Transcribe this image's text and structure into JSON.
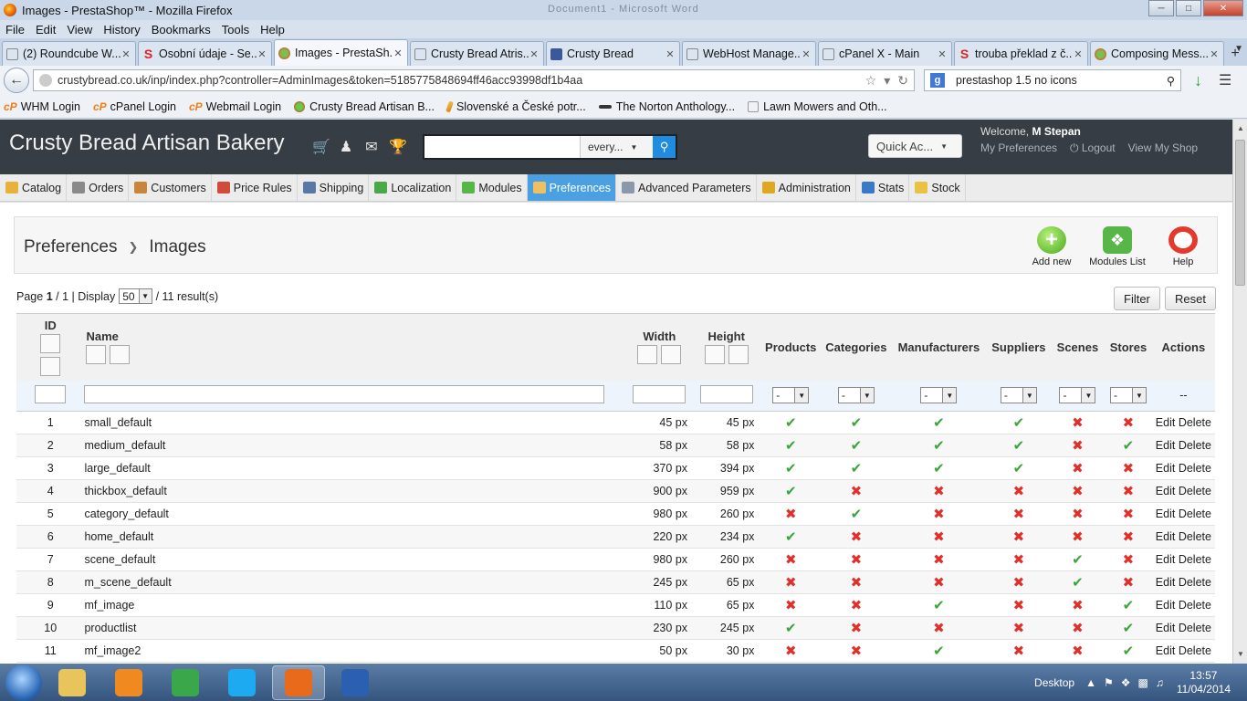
{
  "window": {
    "title": "Images - PrestaShop™ - Mozilla Firefox",
    "background_ghost": "Document1 - Microsoft Word"
  },
  "menubar": [
    "File",
    "Edit",
    "View",
    "History",
    "Bookmarks",
    "Tools",
    "Help"
  ],
  "tabs": [
    {
      "label": "(2) Roundcube W...",
      "icon": "blank"
    },
    {
      "label": "Osobní údaje - Se...",
      "icon": "seznam"
    },
    {
      "label": "Images - PrestaSh...",
      "icon": "prestashop",
      "active": true
    },
    {
      "label": "Crusty Bread Atris...",
      "icon": "blank"
    },
    {
      "label": "Crusty Bread",
      "icon": "facebook"
    },
    {
      "label": "WebHost Manage...",
      "icon": "blank"
    },
    {
      "label": "cPanel X - Main",
      "icon": "blank"
    },
    {
      "label": "trouba překlad z č...",
      "icon": "seznam"
    },
    {
      "label": "Composing Mess...",
      "icon": "prestashop"
    }
  ],
  "nav": {
    "url": "crustybread.co.uk/inp/index.php?controller=AdminImages&token=5185775848694ff46acc93998df1b4aa",
    "search_value": "prestashop 1.5 no icons"
  },
  "bookmarks": [
    {
      "label": "WHM Login",
      "icon": "cp"
    },
    {
      "label": "cPanel Login",
      "icon": "cp"
    },
    {
      "label": "Webmail Login",
      "icon": "cp"
    },
    {
      "label": "Crusty Bread Artisan B...",
      "icon": "green"
    },
    {
      "label": "Slovenské a České potr...",
      "icon": "pen"
    },
    {
      "label": "The Norton Anthology...",
      "icon": "norton"
    },
    {
      "label": "Lawn Mowers and Oth...",
      "icon": "blank"
    }
  ],
  "ps": {
    "shop_name": "Crusty Bread Artisan Bakery",
    "search_scope": "every...",
    "quick_access": "Quick Ac...",
    "welcome_prefix": "Welcome,",
    "user_name": "M Stepan",
    "my_preferences": "My Preferences",
    "logout": "Logout",
    "view_shop": "View My Shop",
    "menu": [
      {
        "label": "Catalog",
        "color": "#e8b23a"
      },
      {
        "label": "Orders",
        "color": "#8a8a8a"
      },
      {
        "label": "Customers",
        "color": "#c9863b"
      },
      {
        "label": "Price Rules",
        "color": "#d24a3a"
      },
      {
        "label": "Shipping",
        "color": "#5a78a6"
      },
      {
        "label": "Localization",
        "color": "#4aa84a"
      },
      {
        "label": "Modules",
        "color": "#58b648"
      },
      {
        "label": "Preferences",
        "color": "#f0c060",
        "active": true
      },
      {
        "label": "Advanced Parameters",
        "color": "#8a98aa"
      },
      {
        "label": "Administration",
        "color": "#e0a820"
      },
      {
        "label": "Stats",
        "color": "#3a78c8"
      },
      {
        "label": "Stock",
        "color": "#e8c240"
      }
    ],
    "breadcrumb": [
      "Preferences",
      "Images"
    ],
    "toolbar": {
      "add_new": "Add new",
      "modules_list": "Modules List",
      "help": "Help"
    },
    "pager": {
      "page_label": "Page",
      "page": "1",
      "pages": "1",
      "display_label": "| Display",
      "per_page": "50",
      "results": "/ 11 result(s)"
    },
    "filter_btn": "Filter",
    "reset_btn": "Reset",
    "columns": {
      "id": "ID",
      "name": "Name",
      "width": "Width",
      "height": "Height",
      "products": "Products",
      "categories": "Categories",
      "manufacturers": "Manufacturers",
      "suppliers": "Suppliers",
      "scenes": "Scenes",
      "stores": "Stores",
      "actions": "Actions"
    },
    "filter_select_value": "-",
    "actions_placeholder": "--",
    "edit_label": "Edit",
    "delete_label": "Delete",
    "rows": [
      {
        "id": "1",
        "name": "small_default",
        "width": "45 px",
        "height": "45 px",
        "products": true,
        "categories": true,
        "manufacturers": true,
        "suppliers": true,
        "scenes": false,
        "stores": false
      },
      {
        "id": "2",
        "name": "medium_default",
        "width": "58 px",
        "height": "58 px",
        "products": true,
        "categories": true,
        "manufacturers": true,
        "suppliers": true,
        "scenes": false,
        "stores": true
      },
      {
        "id": "3",
        "name": "large_default",
        "width": "370 px",
        "height": "394 px",
        "products": true,
        "categories": true,
        "manufacturers": true,
        "suppliers": true,
        "scenes": false,
        "stores": false
      },
      {
        "id": "4",
        "name": "thickbox_default",
        "width": "900 px",
        "height": "959 px",
        "products": true,
        "categories": false,
        "manufacturers": false,
        "suppliers": false,
        "scenes": false,
        "stores": false
      },
      {
        "id": "5",
        "name": "category_default",
        "width": "980 px",
        "height": "260 px",
        "products": false,
        "categories": true,
        "manufacturers": false,
        "suppliers": false,
        "scenes": false,
        "stores": false
      },
      {
        "id": "6",
        "name": "home_default",
        "width": "220 px",
        "height": "234 px",
        "products": true,
        "categories": false,
        "manufacturers": false,
        "suppliers": false,
        "scenes": false,
        "stores": false
      },
      {
        "id": "7",
        "name": "scene_default",
        "width": "980 px",
        "height": "260 px",
        "products": false,
        "categories": false,
        "manufacturers": false,
        "suppliers": false,
        "scenes": true,
        "stores": false
      },
      {
        "id": "8",
        "name": "m_scene_default",
        "width": "245 px",
        "height": "65 px",
        "products": false,
        "categories": false,
        "manufacturers": false,
        "suppliers": false,
        "scenes": true,
        "stores": false
      },
      {
        "id": "9",
        "name": "mf_image",
        "width": "110 px",
        "height": "65 px",
        "products": false,
        "categories": false,
        "manufacturers": true,
        "suppliers": false,
        "scenes": false,
        "stores": true
      },
      {
        "id": "10",
        "name": "productlist",
        "width": "230 px",
        "height": "245 px",
        "products": true,
        "categories": false,
        "manufacturers": false,
        "suppliers": false,
        "scenes": false,
        "stores": true
      },
      {
        "id": "11",
        "name": "mf_image2",
        "width": "50 px",
        "height": "30 px",
        "products": false,
        "categories": false,
        "manufacturers": true,
        "suppliers": false,
        "scenes": false,
        "stores": true
      }
    ]
  },
  "taskbar": {
    "apps": [
      {
        "name": "explorer",
        "color": "#e8c45a"
      },
      {
        "name": "media",
        "color": "#f08a20"
      },
      {
        "name": "chrome",
        "color": "#3aa84a"
      },
      {
        "name": "skype",
        "color": "#1eaaf0"
      },
      {
        "name": "firefox",
        "color": "#e86a1a",
        "active": true
      },
      {
        "name": "word",
        "color": "#2b5fb0"
      }
    ],
    "desktop_label": "Desktop",
    "time": "13:57",
    "date": "11/04/2014"
  },
  "colors": {
    "check": "#3ba53b",
    "cross": "#e0302a",
    "accent": "#4aa0e0"
  }
}
